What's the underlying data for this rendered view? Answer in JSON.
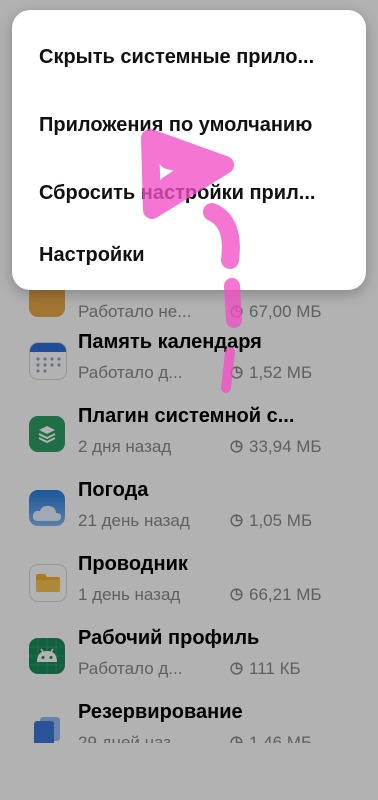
{
  "menu": {
    "items": [
      {
        "label": "Скрыть системные прило..."
      },
      {
        "label": "Приложения по умолчанию"
      },
      {
        "label": "Сбросить настройки прил..."
      },
      {
        "label": "Настройки"
      }
    ]
  },
  "apps": [
    {
      "name": "",
      "meta": "Работало не...",
      "size": "67,00 МБ",
      "icon": "folder-icon"
    },
    {
      "name": "Память календаря",
      "meta": "Работало д...",
      "size": "1,52 МБ",
      "icon": "calendar-icon"
    },
    {
      "name": "Плагин системной с...",
      "meta": "2 дня назад",
      "size": "33,94 МБ",
      "icon": "plugin-icon"
    },
    {
      "name": "Погода",
      "meta": "21 день назад",
      "size": "1,05 МБ",
      "icon": "weather-icon"
    },
    {
      "name": "Проводник",
      "meta": "1 день назад",
      "size": "66,21 МБ",
      "icon": "file-manager-icon"
    },
    {
      "name": "Рабочий профиль",
      "meta": "Работало д...",
      "size": "111 КБ",
      "icon": "android-icon"
    },
    {
      "name": "Резервирование",
      "meta": "29 дней наз...",
      "size": "1,46 МБ",
      "icon": "backup-icon"
    }
  ],
  "colors": {
    "scrim": "#00000049",
    "annotation_pink": "#f24fc5",
    "secondary_text": "#8a8a8a"
  },
  "nav": {
    "recent_icon": "square-icon",
    "home_icon": "circle-icon",
    "back_icon": "triangle-back-icon"
  }
}
